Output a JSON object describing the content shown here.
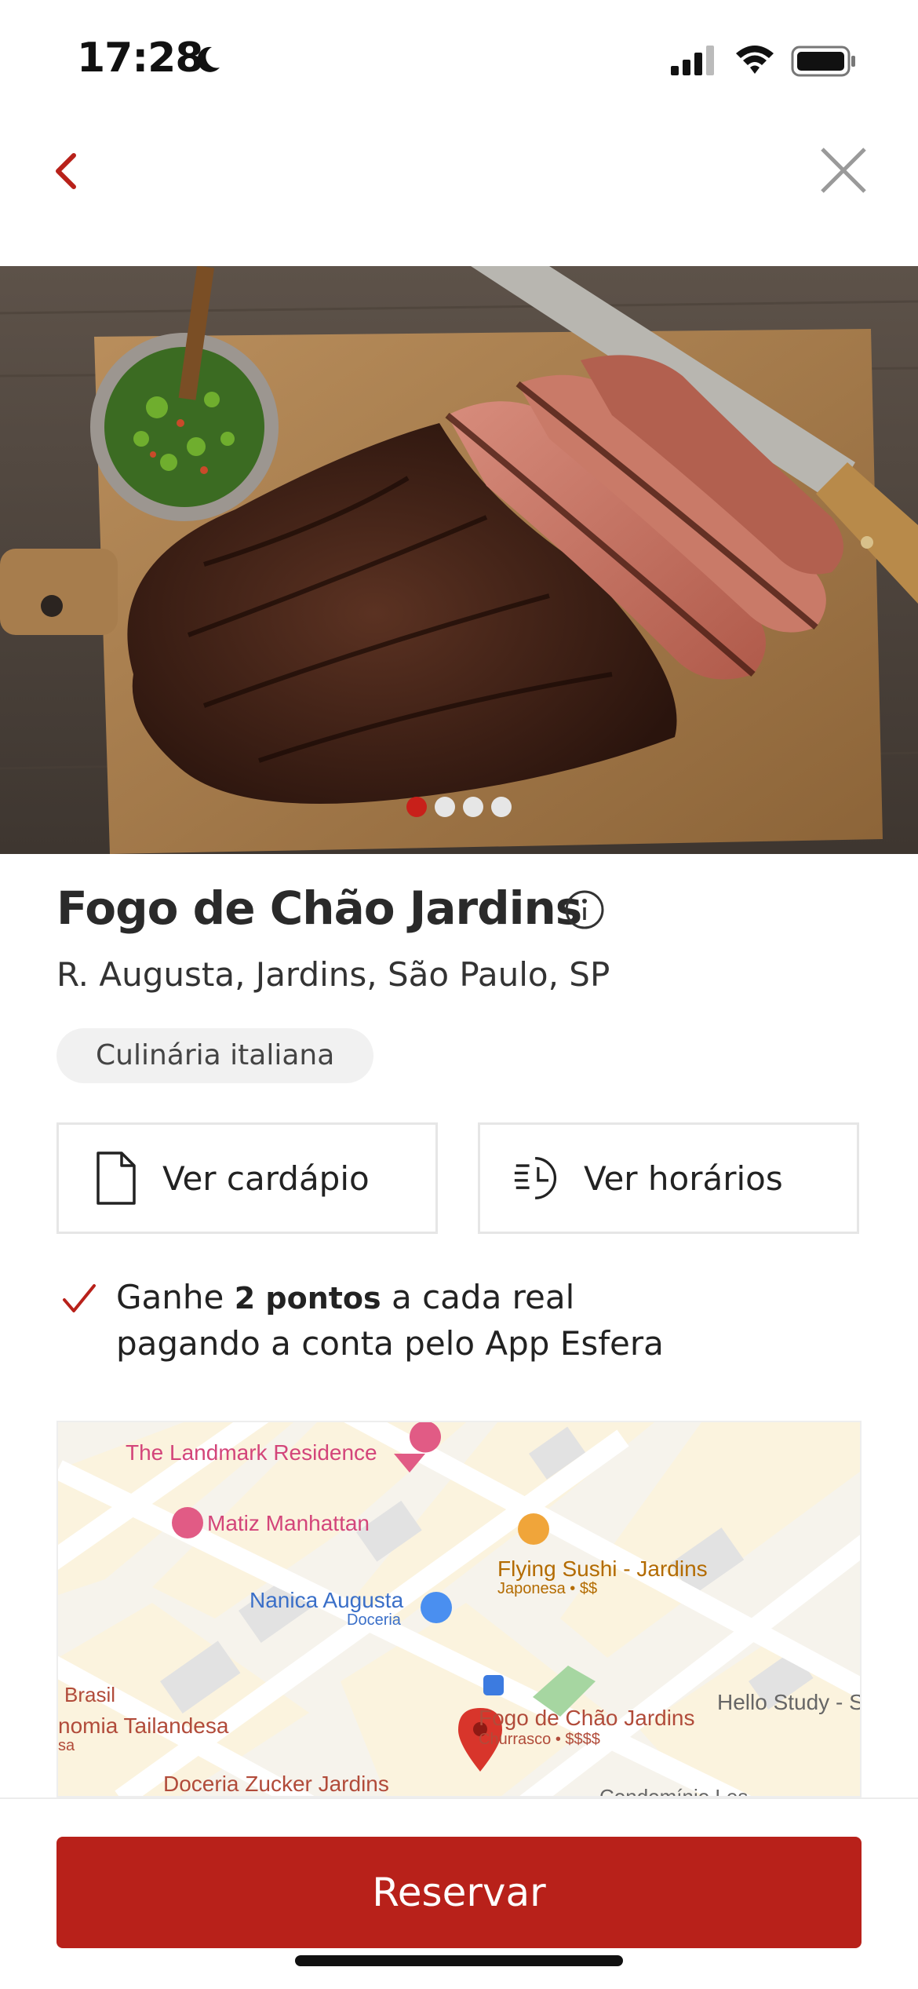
{
  "status_bar": {
    "time": "17:28"
  },
  "restaurant": {
    "name": "Fogo de Chão Jardins",
    "address": "R. Augusta, Jardins, São Paulo, SP",
    "tag": "Culinária italiana"
  },
  "carousel": {
    "count": 4,
    "active_index": 0
  },
  "actions": {
    "menu_label": "Ver cardápio",
    "hours_label": "Ver horários"
  },
  "points": {
    "prefix": "Ganhe ",
    "highlight": "2 pontos",
    "suffix": " a cada real",
    "line2": "pagando a conta pelo App Esfera"
  },
  "map": {
    "labels": {
      "landmark": "The Landmark Residence",
      "matiz": "Matiz Manhattan",
      "flying_sushi": "Flying Sushi - Jardins",
      "flying_sushi_sub": "Japonesa • $$",
      "nanica": "Nanica Augusta",
      "nanica_sub": "Doceria",
      "brasil": "Brasil",
      "tailandesa": "nomia Tailandesa",
      "sa": "sa",
      "fogo": "Fogo de Chão Jardins",
      "fogo_sub": "Churrasco • $$$$",
      "hello": "Hello Study - S",
      "zucker": "Doceria Zucker Jardins",
      "condominio": "Condomínio Les"
    }
  },
  "cta": {
    "label": "Reservar"
  },
  "colors": {
    "accent": "#b8211a",
    "dot_active": "#c8201a"
  }
}
